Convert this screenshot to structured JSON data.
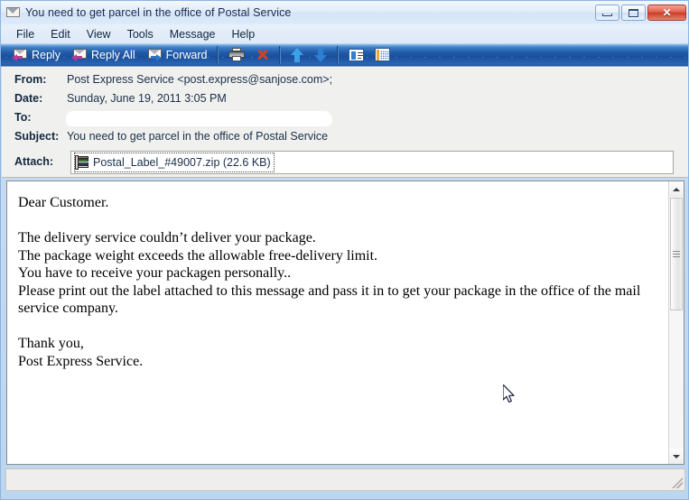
{
  "window": {
    "title": "You need to get parcel in the office of Postal Service",
    "title_icon": "envelope-icon",
    "controls": {
      "minimize_label": "—",
      "maximize_label": "□",
      "close_label": "✕"
    },
    "accent_toolbar_color": "#1f5aa8",
    "header_panel_color": "#f0f0ee",
    "close_button_color": "#c93c26"
  },
  "menu": {
    "items": [
      {
        "label": "File",
        "name": "menu-file"
      },
      {
        "label": "Edit",
        "name": "menu-edit"
      },
      {
        "label": "View",
        "name": "menu-view"
      },
      {
        "label": "Tools",
        "name": "menu-tools"
      },
      {
        "label": "Message",
        "name": "menu-message"
      },
      {
        "label": "Help",
        "name": "menu-help"
      }
    ]
  },
  "toolbar": {
    "reply_label": "Reply",
    "reply_all_label": "Reply All",
    "forward_label": "Forward",
    "icons": {
      "reply": "reply-envelope-icon",
      "reply_all": "reply-all-envelope-icon",
      "forward": "forward-envelope-icon",
      "print": "printer-icon",
      "delete": "delete-x-icon",
      "previous": "up-arrow-icon",
      "next": "down-arrow-icon",
      "addresses": "contact-card-icon",
      "folders": "grid-icon"
    }
  },
  "headers": {
    "from_label": "From:",
    "from_value": "Post Express Service <post.express@sanjose.com>;",
    "date_label": "Date:",
    "date_value": "Sunday, June 19, 2011 3:05 PM",
    "to_label": "To:",
    "to_value": "",
    "subject_label": "Subject:",
    "subject_value": "You need to get parcel in the office of Postal Service",
    "attach_label": "Attach:",
    "attachment": {
      "filename": "Postal_Label_#49007.zip",
      "size": "(22.6 KB)",
      "display": "Postal_Label_#49007.zip (22.6 KB)",
      "icon": "zip-archive-icon"
    }
  },
  "body": {
    "text": "Dear Customer.\n\nThe delivery service couldn’t deliver your package.\nThe package weight exceeds the allowable free-delivery limit.\nYou have to receive your packagen personally..\nPlease print out the label attached to this message and pass it in to get your package in the office of the mail service company.\n\nThank you,\nPost Express Service."
  },
  "scrollbar": {
    "up_arrow": "scroll-up-arrow-icon",
    "down_arrow": "scroll-down-arrow-icon",
    "thumb": "scroll-thumb"
  },
  "statusbar": {
    "text": ""
  }
}
